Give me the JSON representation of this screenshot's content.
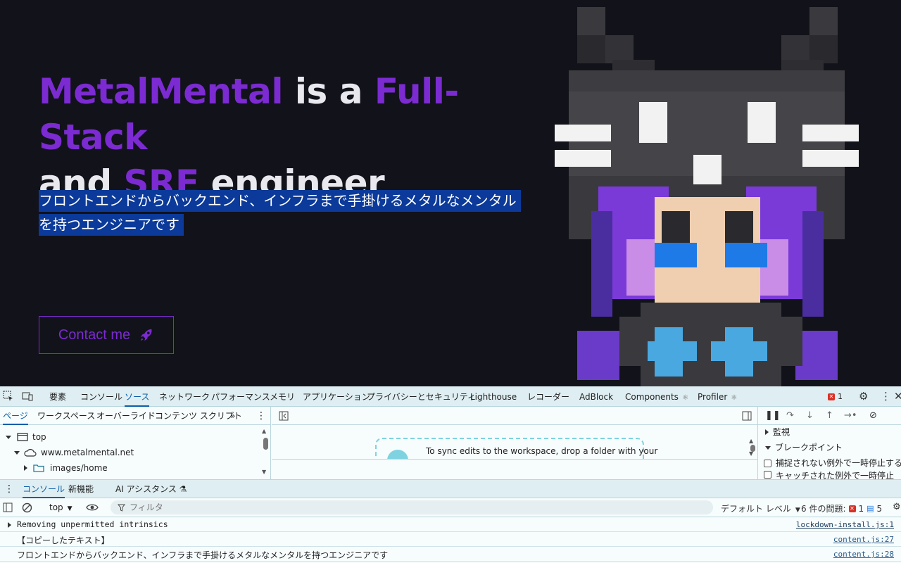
{
  "hero": {
    "headline": {
      "brand": "MetalMental",
      "part1": " is a ",
      "accent1": "Full-Stack",
      "part2": "and ",
      "accent2": "SRE",
      "part3": " engineer"
    },
    "tagline_line1": "フロントエンドからバックエンド、インフラまで手掛けるメタルなメンタル",
    "tagline_line2": "を持つエンジニアです",
    "contact_label": "Contact me",
    "colors": {
      "accent": "#7b2bd1",
      "background": "#12121b",
      "selection": "#0b3a9a"
    }
  },
  "devtools": {
    "tabs": [
      "要素",
      "コンソール",
      "ソース",
      "ネットワーク",
      "パフォーマンス",
      "メモリ",
      "アプリケーション",
      "プライバシーとセキュリティ",
      "Lighthouse",
      "レコーダー",
      "AdBlock",
      "Components",
      "Profiler"
    ],
    "active_tab": "ソース",
    "issue_count_top": "1",
    "sources": {
      "subtabs": [
        "ページ",
        "ワークスペース",
        "オーバーライド",
        "コンテンツ スクリプト"
      ],
      "tree": [
        {
          "label": "top"
        },
        {
          "label": "www.metalmental.net"
        },
        {
          "label": "images/home"
        }
      ],
      "drop_text": "To sync edits to the workspace, drop a folder with your",
      "debug_sections": {
        "watch": "監視",
        "breakpoints": "ブレークポイント"
      },
      "checks": [
        "捕捉されない例外で一時停止する",
        "キャッチされた例外で一時停止"
      ]
    },
    "drawer": {
      "tabs": [
        "コンソール",
        "新機能",
        "AI アシスタンス"
      ],
      "context": "top",
      "filter_placeholder": "フィルタ",
      "level": "デフォルト レベル",
      "issues_label": "6 件の問題:",
      "issues_errors": "1",
      "issues_info": "5"
    },
    "messages": [
      {
        "text": "Removing unpermitted intrinsics",
        "source": "lockdown-install.js:1"
      },
      {
        "text": "【コピーしたテキスト】",
        "source": "content.js:27"
      },
      {
        "text": "フロントエンドからバックエンド、インフラまで手掛けるメタルなメンタルを持つエンジニアです",
        "source": "content.js:28"
      }
    ]
  }
}
